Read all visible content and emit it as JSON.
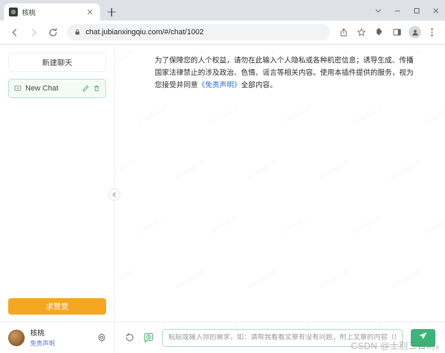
{
  "browser": {
    "tab": {
      "title": "核桃",
      "favicon": "walnut-favicon",
      "close_label": "×"
    },
    "new_tab_label": "+",
    "window_controls": {
      "chevron": "⌄",
      "minimize": "—",
      "maximize": "□",
      "close": "✕"
    },
    "nav": {
      "back": "←",
      "forward": "→",
      "reload": "⟳"
    },
    "omnibox": {
      "lock": "lock-icon",
      "url": "chat.jubianxingqiu.com/#/chat/1002"
    },
    "toolbar_icons": [
      "share-icon",
      "bookmark-star-icon",
      "extensions-puzzle-icon",
      "side-panel-icon",
      "profile-avatar-icon",
      "chrome-menu-icon"
    ]
  },
  "sidebar": {
    "new_chat_button": "新建聊天",
    "chats": [
      {
        "label": "New Chat",
        "edit": "edit-icon",
        "delete": "trash-icon"
      }
    ],
    "donate_button": "求赞赏",
    "profile": {
      "name": "核桃",
      "link": "免责声明",
      "settings": "gear-icon"
    },
    "collapse": "chevron-left-icon"
  },
  "main": {
    "disclaimer": {
      "part1": "为了保障您的人个权益，请勿在此输入个人隐私或各种机密信息；诱导生成、传播国家法律禁止的涉及政治、色情、谣言等相关内容。使用本插件提供的服务，视为您接受并同意",
      "link": "《免责声明》",
      "part2": "全部内容。"
    },
    "watermark_tile": "#1012342178"
  },
  "composer": {
    "refresh_icon": "refresh-icon",
    "history_icon": "history-clock-icon",
    "input_value": "",
    "placeholder": "粘贴或输入你的需求，如：请帮我看看文章有没有问题，附上文章的内容（Shift + Enter = 换行）",
    "send_icon": "send-plane-icon"
  },
  "page_watermark": {
    "text": "CSDN @士别三日",
    "suffix": "wyx"
  },
  "colors": {
    "accent_green": "#3fb37a",
    "donate_orange": "#f5a623",
    "link_blue": "#2f6fd8",
    "chrome_gray": "#dee1e6"
  }
}
